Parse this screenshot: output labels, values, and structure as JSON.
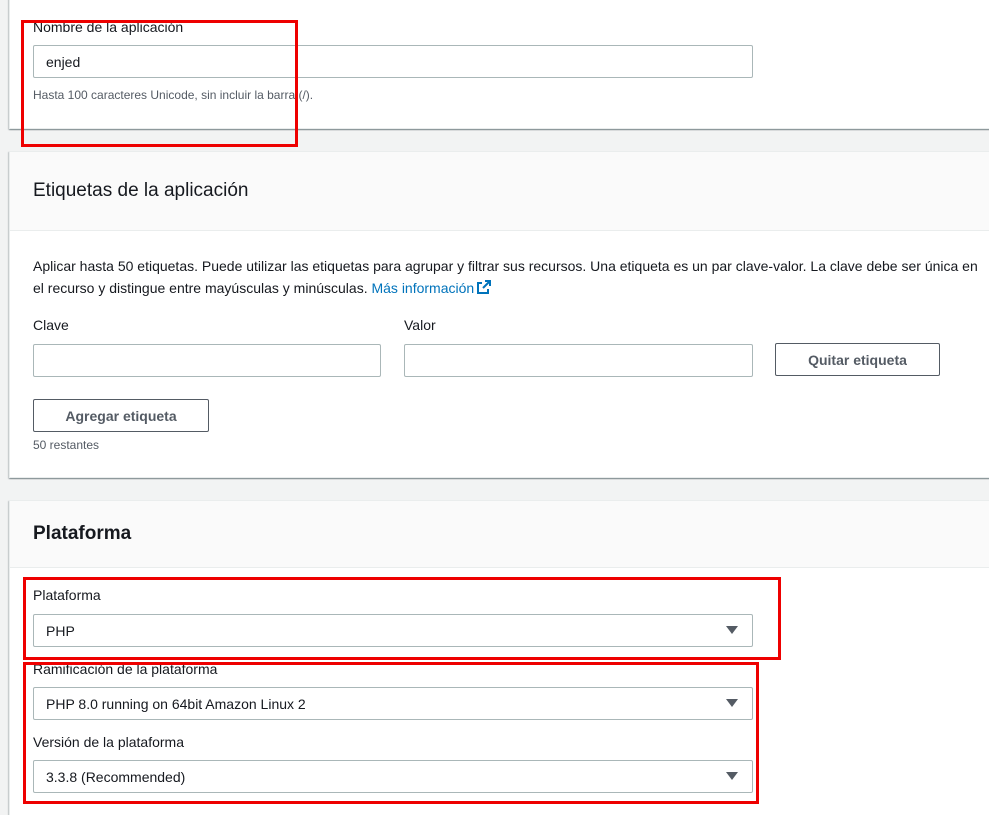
{
  "app_name_section": {
    "label": "Nombre de la aplicación",
    "value": "enjed",
    "hint": "Hasta 100 caracteres Unicode, sin incluir la barra (/)."
  },
  "tags_section": {
    "title": "Etiquetas de la aplicación",
    "description": "Aplicar hasta 50 etiquetas. Puede utilizar las etiquetas para agrupar y filtrar sus recursos. Una etiqueta es un par clave-valor. La clave debe ser única en el recurso y distingue entre mayúsculas y minúsculas.",
    "learn_more": "Más información",
    "key_label": "Clave",
    "value_label": "Valor",
    "key_value": "",
    "value_value": "",
    "remove_button": "Quitar etiqueta",
    "add_button": "Agregar etiqueta",
    "remaining": "50 restantes"
  },
  "platform_section": {
    "title": "Plataforma",
    "platform_label": "Plataforma",
    "platform_value": "PHP",
    "branch_label": "Ramificación de la plataforma",
    "branch_value": "PHP 8.0 running on 64bit Amazon Linux 2",
    "version_label": "Versión de la plataforma",
    "version_value": "3.3.8 (Recommended)"
  },
  "colors": {
    "highlight": "#ee0000",
    "link": "#0073bb",
    "border": "#aab7b8"
  }
}
